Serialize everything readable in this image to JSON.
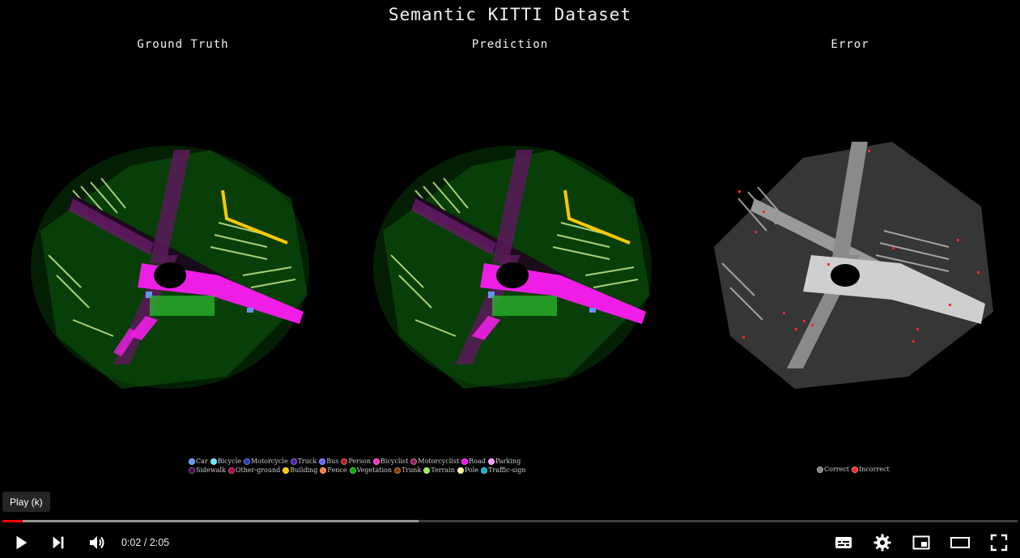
{
  "video": {
    "title": "Semantic KITTI Dataset",
    "panels": [
      {
        "title": "Ground Truth"
      },
      {
        "title": "Prediction"
      },
      {
        "title": "Error"
      }
    ],
    "legend_semantic": {
      "row1": [
        {
          "label": "Car",
          "color": "#6495ed"
        },
        {
          "label": "Bicycle",
          "color": "#64e6f5"
        },
        {
          "label": "Motorcycle",
          "color": "#1e3cb4"
        },
        {
          "label": "Truck",
          "color": "#501eb"
        },
        {
          "label": "Bus",
          "color": "#6464ff"
        },
        {
          "label": "Person",
          "color": "#ff1e1e"
        },
        {
          "label": "Bicyclist",
          "color": "#ff28c8"
        },
        {
          "label": "Motorcyclist",
          "color": "#961e5a"
        },
        {
          "label": "Road",
          "color": "#ff00ff"
        },
        {
          "label": "Parking",
          "color": "#ff96ff"
        }
      ],
      "row2": [
        {
          "label": "Sidewalk",
          "color": "#4b004b"
        },
        {
          "label": "Other-ground",
          "color": "#af004b"
        },
        {
          "label": "Building",
          "color": "#ffc800"
        },
        {
          "label": "Fence",
          "color": "#ff7832"
        },
        {
          "label": "Vegetation",
          "color": "#00af00"
        },
        {
          "label": "Trunk",
          "color": "#873c00"
        },
        {
          "label": "Terrain",
          "color": "#96f050"
        },
        {
          "label": "Pole",
          "color": "#fff096"
        },
        {
          "label": "Traffic-sign",
          "color": "#ff0000"
        }
      ]
    },
    "legend_error": [
      {
        "label": "Correct",
        "color": "#808080"
      },
      {
        "label": "Incorrect",
        "color": "#ff2a2a"
      }
    ]
  },
  "player": {
    "tooltip": "Play (k)",
    "time_current": "0:02",
    "time_separator": " / ",
    "time_total": "2:05",
    "progress_played_fraction": 0.02,
    "progress_buffered_fraction": 0.41,
    "buttons": {
      "play": "play-icon",
      "next": "next-icon",
      "volume": "volume-icon",
      "subtitles": "subtitles-icon",
      "settings": "gear-icon",
      "miniplayer": "miniplayer-icon",
      "theater": "theater-icon",
      "fullscreen": "fullscreen-icon"
    }
  }
}
